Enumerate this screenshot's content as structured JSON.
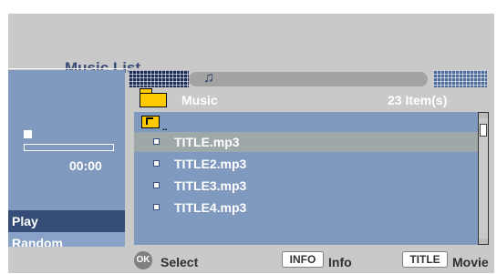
{
  "header": {
    "title": "Music List"
  },
  "left_panel": {
    "time": "00:00",
    "options": [
      {
        "label": "Play"
      },
      {
        "label": "Random"
      }
    ]
  },
  "folder": {
    "name": "Music",
    "count": "23 Item(s)"
  },
  "list": {
    "items": [
      {
        "label": "TITLE.mp3",
        "selected": true
      },
      {
        "label": "TITLE2.mp3",
        "selected": false
      },
      {
        "label": "TITLE3.mp3",
        "selected": false
      },
      {
        "label": "TITLE4.mp3",
        "selected": false
      }
    ]
  },
  "footer": {
    "ok_label": "OK",
    "select_label": "Select",
    "info_button": "INFO",
    "info_label": "Info",
    "title_button": "TITLE",
    "movie_label": "Movie"
  },
  "icons": {
    "music_note": "music-note-icon",
    "folder": "folder-icon",
    "up_folder": "up-folder-icon",
    "file": "file-icon"
  },
  "colors": {
    "panel_blue": "#7f99bf",
    "selected_option": "#364d78",
    "selected_row": "#9ea8a9",
    "folder_yellow": "#ffcb00",
    "background_gray": "#c9c9c9"
  }
}
